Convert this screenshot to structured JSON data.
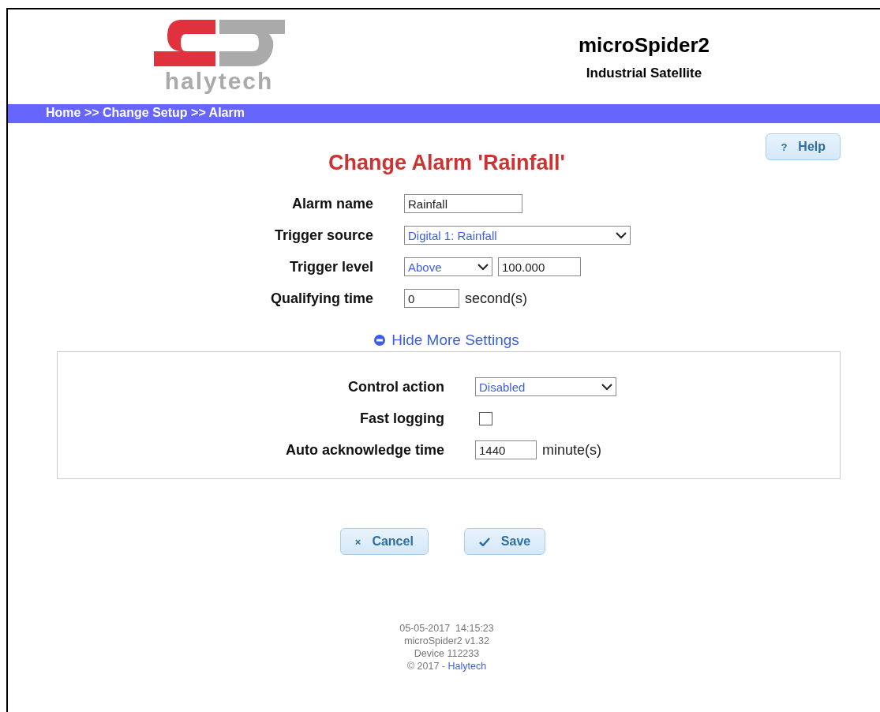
{
  "header": {
    "logo_text": "halytech",
    "title": "microSpider2",
    "subtitle": "Industrial Satellite"
  },
  "breadcrumb": "Home >> Change Setup >> Alarm",
  "help_button": {
    "icon": "?",
    "label": "Help"
  },
  "heading": "Change Alarm 'Rainfall'",
  "fields": [
    {
      "label": "Alarm name",
      "controls": [
        {
          "kind": "text",
          "value": "Rainfall"
        }
      ]
    },
    {
      "label": "Trigger source",
      "controls": [
        {
          "kind": "select",
          "value": "Digital 1: Rainfall"
        }
      ]
    },
    {
      "label": "Trigger level",
      "controls": [
        {
          "kind": "select",
          "value": "Above"
        },
        {
          "kind": "text",
          "value": "100.000"
        }
      ]
    },
    {
      "label": "Qualifying time",
      "controls": [
        {
          "kind": "text",
          "value": "0"
        },
        {
          "kind": "unit",
          "text": "second(s)"
        }
      ]
    }
  ],
  "more_settings": {
    "label": "Hide More Settings",
    "expanded": true,
    "fields": [
      {
        "label": "Control action",
        "controls": [
          {
            "kind": "select",
            "value": "Disabled"
          }
        ]
      },
      {
        "label": "Fast logging",
        "controls": [
          {
            "kind": "checkbox",
            "checked": false
          }
        ]
      },
      {
        "label": "Auto acknowledge time",
        "controls": [
          {
            "kind": "text",
            "value": "1440"
          },
          {
            "kind": "unit",
            "text": "minute(s)"
          }
        ]
      }
    ]
  },
  "buttons": [
    {
      "kind": "cancel",
      "icon": "×",
      "label": "Cancel"
    },
    {
      "kind": "save",
      "label": "Save"
    }
  ],
  "footer": {
    "lines": [
      "05-05-2017  14:15:23",
      "microSpider2 v1.32",
      "Device 112233"
    ],
    "copyright": "© 2017 - ",
    "link": "Halytech"
  }
}
